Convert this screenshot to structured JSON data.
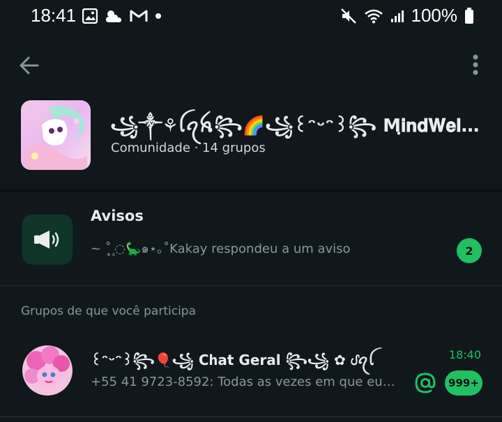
{
  "status_bar": {
    "time": "18:41",
    "battery": "100%"
  },
  "community": {
    "title": "꧁༒⚘ꪶꪖꫝ꧂🌈꧁꒰ᵔᵕᵔ꒱꧂ Mฺ𝐢𝐧𝐝𝐖𝐞𝐥𝐭 ꧁✿꧂🍧",
    "subtitle": "Comunidade · 14 grupos"
  },
  "announcements": {
    "title": "Avisos",
    "last_message": "~ ˚ ͙۪۪̥◌🦕๑⋆｡˚Kakay respondeu a um aviso",
    "unread": "2"
  },
  "section_label": "Grupos de que você participa",
  "groups": [
    {
      "name": "꒰ᵔᵕᵔ꒱꧂🎈꧁ Cհat Geral ꧂꧁ ✿ ᦔꪖꪶ",
      "time": "18:40",
      "preview": "+55 41 9723-8592: Todas as vezes em que eu…",
      "unread": "999+"
    }
  ],
  "colors": {
    "background": "#11181c",
    "accent": "#21c063",
    "secondary_text": "#8696a0"
  },
  "icons": {
    "back": "arrow-left-icon",
    "more": "more-vertical-icon",
    "announcements": "megaphone-icon",
    "mention": "at-icon"
  }
}
